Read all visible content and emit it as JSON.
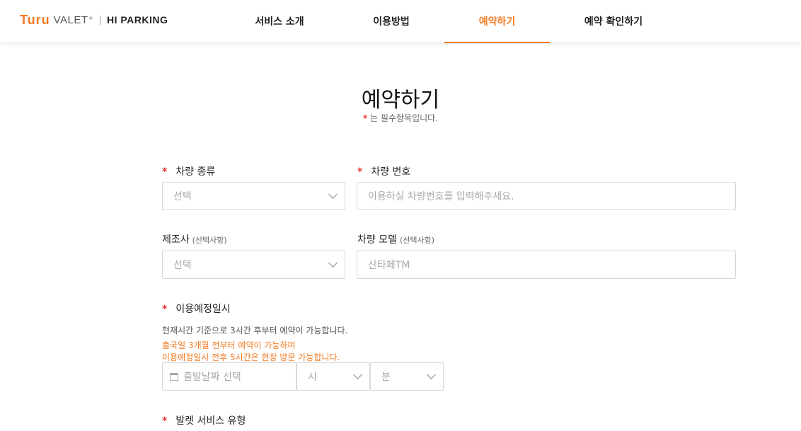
{
  "logo": {
    "turu": "Turu",
    "valet": "VALET⁺",
    "hiparking": "HI PARKING"
  },
  "nav": {
    "items": [
      {
        "label": "서비스 소개"
      },
      {
        "label": "이용방법"
      },
      {
        "label": "예약하기"
      },
      {
        "label": "예약 확인하기"
      }
    ],
    "active_index": 2
  },
  "page": {
    "title": "예약하기",
    "required_star": "*",
    "required_note": "는 필수항목입니다."
  },
  "form": {
    "star": "*",
    "car_type": {
      "label": "차량 종류",
      "value": "선택"
    },
    "car_number": {
      "label": "차량 번호",
      "placeholder": "이용하실 차량번호를 입력해주세요."
    },
    "maker": {
      "label": "제조사",
      "optional": "(선택사항)",
      "value": "선택"
    },
    "model": {
      "label": "차량 모델",
      "optional": "(선택사항)",
      "placeholder": "산타페TM"
    },
    "schedule": {
      "label": "이용예정일시",
      "help": "현재시간 기준으로 3시간 후부터 예약이 가능합니다.",
      "warn1": "출국일 3개월 전부터 예약이 가능하며",
      "warn2": "이용예정일시 전후 5시간은 현장 방문 가능합니다.",
      "date_placeholder": "출발날짜 선택",
      "hour_value": "시",
      "minute_value": "분"
    },
    "service_type": {
      "label": "발렛 서비스 유형"
    }
  },
  "colors": {
    "accent": "#f37a21",
    "required": "#e8372c"
  }
}
